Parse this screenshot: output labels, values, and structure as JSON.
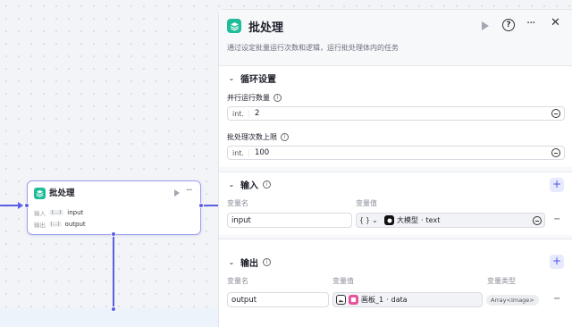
{
  "canvas": {
    "node": {
      "title": "批处理",
      "rows": [
        {
          "label": "输入",
          "tag": "{...}",
          "value": "input"
        },
        {
          "label": "输出",
          "tag": "[...]",
          "value": "output"
        }
      ]
    }
  },
  "panel": {
    "title": "批处理",
    "description": "通过设定批量运行次数和逻辑，运行批处理体内的任务",
    "loop": {
      "title": "循环设置",
      "concurrency_label": "并行运行数量",
      "concurrency_type": "int.",
      "concurrency_value": "2",
      "max_label": "批处理次数上限",
      "max_type": "int.",
      "max_value": "100"
    },
    "input": {
      "title": "输入",
      "col_name": "变量名",
      "col_value": "变量值",
      "rows": [
        {
          "name": "input",
          "ref_type": "{ }",
          "ref_source": "大模型",
          "ref_field": "text"
        }
      ]
    },
    "output": {
      "title": "输出",
      "col_name": "变量名",
      "col_value": "变量值",
      "col_type": "变量类型",
      "rows": [
        {
          "name": "output",
          "ref_source": "画板_1",
          "ref_field": "data",
          "type": "Array<Image>"
        }
      ]
    }
  },
  "icons": {
    "node_icon": "batch-icon",
    "accent": "#4d53e8",
    "teal": "#1ebc9a"
  }
}
